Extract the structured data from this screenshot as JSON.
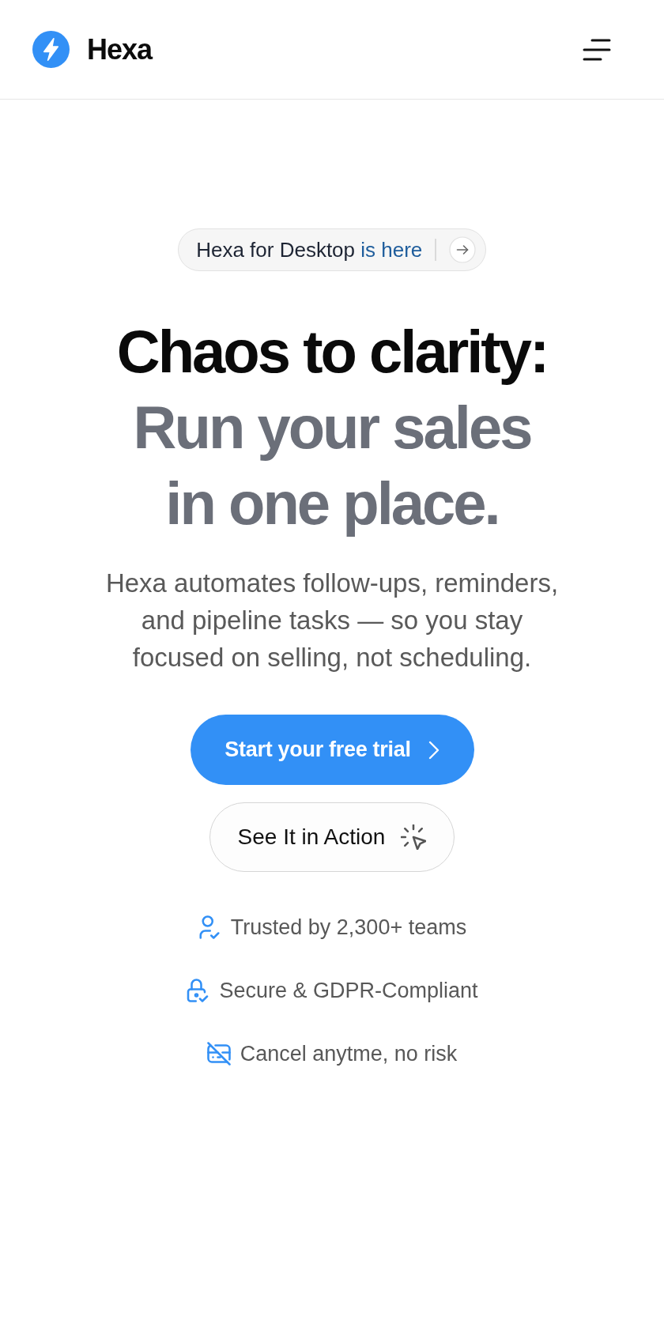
{
  "header": {
    "brand": "Hexa"
  },
  "announcement": {
    "text": "Hexa for Desktop",
    "highlight": "is here"
  },
  "hero": {
    "title": "Chaos to clarity:",
    "title_highlight": "Run your sales in one place.",
    "description": "Hexa automates follow-ups, reminders, and pipeline tasks — so you stay focused on selling, not scheduling."
  },
  "buttons": [
    {
      "label": "Start your free trial",
      "kind": "primary"
    },
    {
      "label": "See It in Action",
      "kind": "secondary"
    }
  ],
  "trust_items": [
    {
      "text": "Trusted by 2,300+ teams",
      "kind": "user"
    },
    {
      "text": "Secure & GDPR-Compliant",
      "kind": "lock"
    },
    {
      "text": "Cancel anytme, no risk",
      "kind": "card"
    }
  ]
}
